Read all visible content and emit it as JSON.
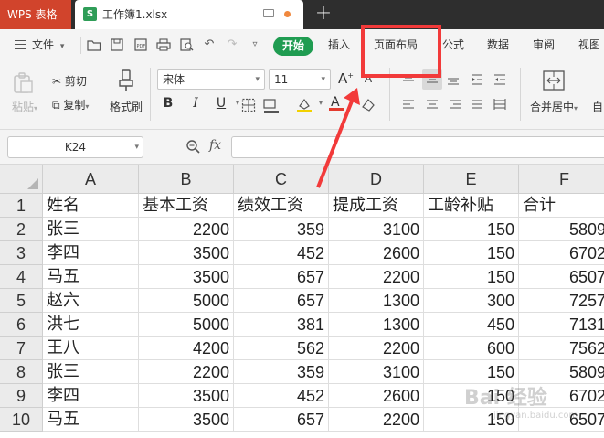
{
  "titlebar": {
    "app_name": "WPS 表格",
    "file_name": "工作簿1.xlsx",
    "file_icon_letter": "S",
    "new_tab_label": "+"
  },
  "menu": {
    "file_label": "文件",
    "tabs": [
      {
        "label": "开始",
        "active": true
      },
      {
        "label": "插入"
      },
      {
        "label": "页面布局",
        "highlighted": true
      },
      {
        "label": "公式"
      },
      {
        "label": "数据"
      },
      {
        "label": "审阅"
      },
      {
        "label": "视图"
      }
    ]
  },
  "ribbon": {
    "paste_label": "粘贴",
    "cut_label": "剪切",
    "copy_label": "复制",
    "format_painter_label": "格式刷",
    "font_name": "宋体",
    "font_size": "11",
    "bold": "B",
    "italic": "I",
    "underline": "U",
    "grow_font": "A",
    "shrink_font": "A",
    "merge_center_label": "合并居中",
    "auto_wrap_label": "自"
  },
  "formula_bar": {
    "cell_ref": "K24",
    "fx_label": "fx",
    "value": ""
  },
  "sheet": {
    "columns": [
      "A",
      "B",
      "C",
      "D",
      "E",
      "F"
    ],
    "row_numbers": [
      "1",
      "2",
      "3",
      "4",
      "5",
      "6",
      "7",
      "8",
      "9",
      "10"
    ],
    "header_row": [
      "姓名",
      "基本工资",
      "绩效工资",
      "提成工资",
      "工龄补贴",
      "合计"
    ],
    "rows": [
      [
        "张三",
        "2200",
        "359",
        "3100",
        "150",
        "5809"
      ],
      [
        "李四",
        "3500",
        "452",
        "2600",
        "150",
        "6702"
      ],
      [
        "马五",
        "3500",
        "657",
        "2200",
        "150",
        "6507"
      ],
      [
        "赵六",
        "5000",
        "657",
        "1300",
        "300",
        "7257"
      ],
      [
        "洪七",
        "5000",
        "381",
        "1300",
        "450",
        "7131"
      ],
      [
        "王八",
        "4200",
        "562",
        "2200",
        "600",
        "7562"
      ],
      [
        "张三",
        "2200",
        "359",
        "3100",
        "150",
        "5809"
      ],
      [
        "李四",
        "3500",
        "452",
        "2600",
        "150",
        "6702"
      ],
      [
        "马五",
        "3500",
        "657",
        "2200",
        "150",
        "6507"
      ]
    ]
  },
  "colors": {
    "wps_red": "#d1442c",
    "start_green": "#1f9c51",
    "annotation_red": "#f23a3a"
  },
  "watermark": {
    "text": "Bai 经验",
    "sub": "jingyan.baidu.com"
  }
}
